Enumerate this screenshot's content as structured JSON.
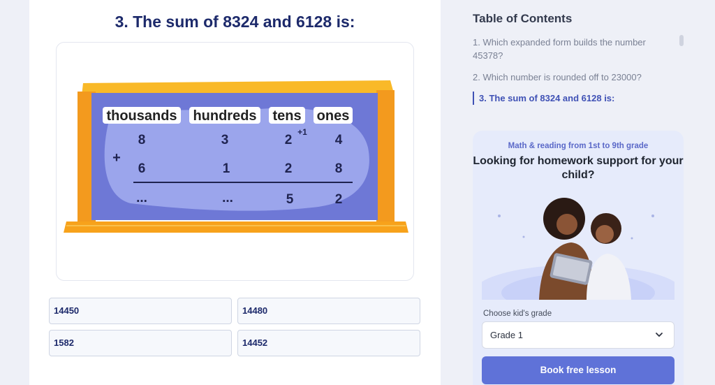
{
  "question": {
    "title": "3. The sum of 8324 and 6128 is:",
    "board": {
      "columns": [
        "thousands",
        "hundreds",
        "tens",
        "ones"
      ],
      "carry": "+1",
      "plus": "+",
      "row1": [
        "8",
        "3",
        "2",
        "4"
      ],
      "row2": [
        "6",
        "1",
        "2",
        "8"
      ],
      "result": [
        "...",
        "...",
        "5",
        "2"
      ]
    },
    "answers": [
      "14450",
      "14480",
      "1582",
      "14452"
    ]
  },
  "toc": {
    "title": "Table of Contents",
    "items": [
      {
        "label": "1. Which expanded form builds the number 45378?",
        "active": false
      },
      {
        "label": "2. Which number is rounded off to 23000?",
        "active": false
      },
      {
        "label": "3. The sum of 8324 and 6128 is:",
        "active": true
      }
    ]
  },
  "promo": {
    "tagline": "Math & reading from 1st to 9th grade",
    "heading": "Looking for homework support for your child?",
    "grade_label": "Choose kid's grade",
    "grade_value": "Grade 1",
    "button_label": "Book free lesson"
  },
  "icons": {
    "dropdown": "chevron-down-icon",
    "illustration": "mother-daughter-tablet-illustration"
  },
  "colors": {
    "heading": "#1d2a6b",
    "accent": "#5f72d8",
    "active_toc": "#3f51b5",
    "board_frame": "#f7a21b",
    "board_face": "#6e78d6"
  }
}
